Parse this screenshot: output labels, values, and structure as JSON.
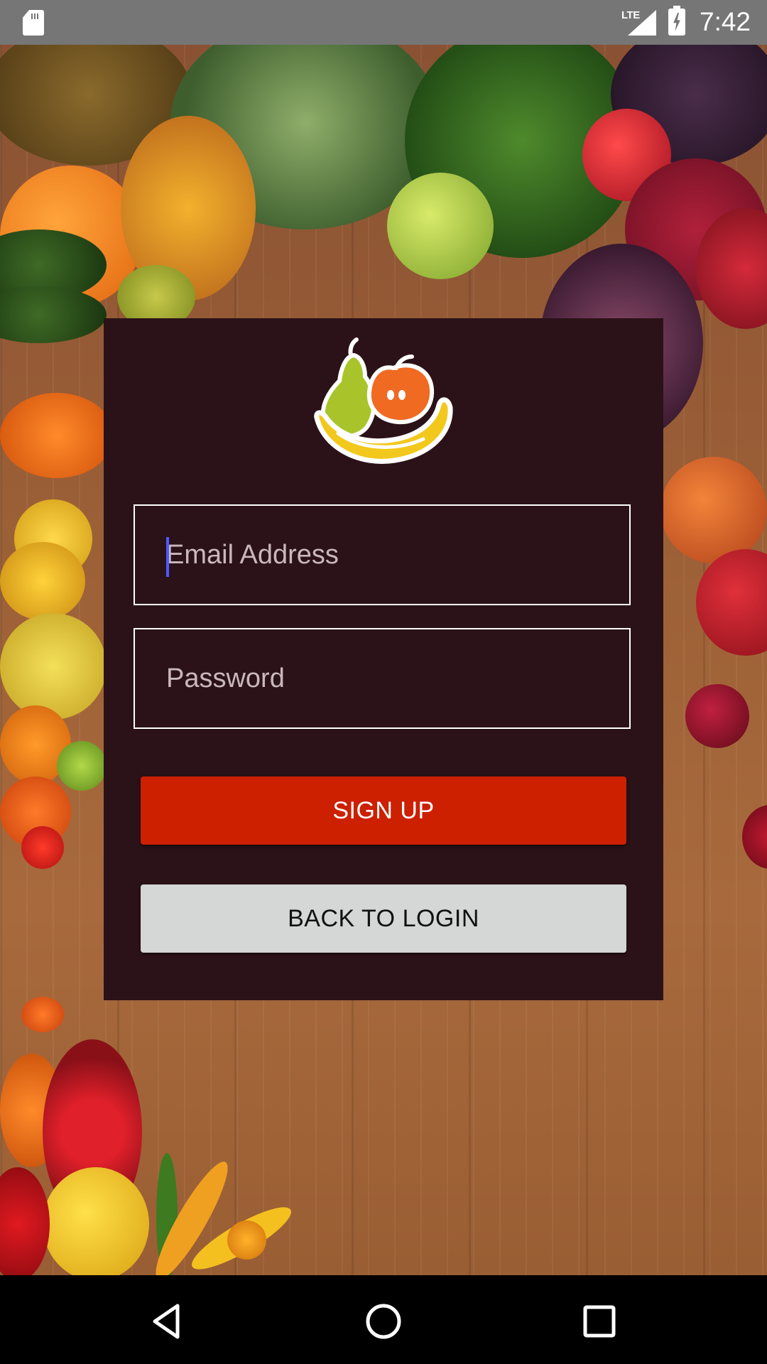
{
  "status_bar": {
    "network": "LTE",
    "time": "7:42",
    "icons": [
      "sd-card-icon",
      "signal-icon",
      "battery-charging-icon"
    ]
  },
  "signup_form": {
    "email_placeholder": "Email Address",
    "email_value": "",
    "password_placeholder": "Password",
    "password_value": "",
    "signup_label": "SIGN UP",
    "back_label": "BACK TO LOGIN"
  },
  "colors": {
    "card_background": "#2b1218",
    "signup_button": "#cc2000",
    "back_button": "#d5d6d6",
    "status_bar": "#767676"
  },
  "nav_bar": {
    "icons": [
      "back-icon",
      "home-icon",
      "recents-icon"
    ]
  }
}
